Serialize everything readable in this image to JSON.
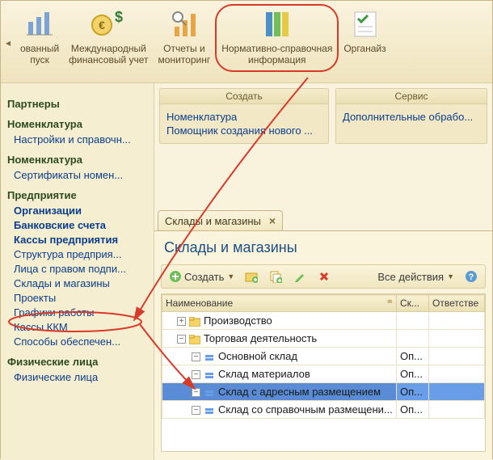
{
  "toolbar": {
    "items": [
      {
        "label1": "ованный",
        "label2": "пуск"
      },
      {
        "label1": "Международный",
        "label2": "финансовый учет"
      },
      {
        "label1": "Отчеты и",
        "label2": "мониторинг"
      },
      {
        "label1": "Нормативно-справочная",
        "label2": "информация"
      },
      {
        "label1": "Органайз",
        "label2": ""
      }
    ]
  },
  "sidebar": {
    "g1": {
      "h": "Партнеры"
    },
    "g1b": {
      "h": "Номенклатура"
    },
    "links1": {
      "settings": "Настройки и справочн..."
    },
    "group_nomen": "Номенклатура",
    "links2": {
      "cert": "Сертификаты номен..."
    },
    "group_ent": "Предприятие",
    "links3": {
      "org": "Организации",
      "bank": "Банковские счета",
      "kassy": "Кассы предприятия",
      "struct": "Структура предприя...",
      "persons": "Лица с правом подпи...",
      "warehouses": "Склады и магазины",
      "projects": "Проекты",
      "schedules": "Графики работы",
      "kkm": "Кассы ККМ",
      "methods": "Способы обеспечен..."
    },
    "group_phys": "Физические лица",
    "links4": {
      "phys": "Физические лица"
    }
  },
  "banners": {
    "create": {
      "title": "Создать",
      "items": [
        "Номенклатура",
        "Помощник создания нового ..."
      ]
    },
    "service": {
      "title": "Сервис",
      "items": [
        "Дополнительные обрабо..."
      ]
    }
  },
  "tab": {
    "title": "Склады и магазины"
  },
  "page": {
    "title": "Склады и магазины"
  },
  "gridtb": {
    "create": "Создать",
    "actions": "Все действия"
  },
  "grid": {
    "headers": {
      "name": "Наименование",
      "sk": "Ск...",
      "resp": "Ответстве"
    },
    "rows": [
      {
        "kind": "folder",
        "indent": 0,
        "exp": "+",
        "name": "Производство",
        "sk": "",
        "resp": ""
      },
      {
        "kind": "folder",
        "indent": 0,
        "exp": "−",
        "name": "Торговая деятельность",
        "sk": "",
        "resp": ""
      },
      {
        "kind": "item",
        "indent": 1,
        "exp": "−",
        "name": "Основной склад",
        "sk": "Оп...",
        "resp": ""
      },
      {
        "kind": "item",
        "indent": 1,
        "exp": "−",
        "name": "Склад материалов",
        "sk": "Оп...",
        "resp": ""
      },
      {
        "kind": "item",
        "indent": 1,
        "exp": "−",
        "name": "Склад с адресным размещением",
        "sk": "Оп...",
        "resp": "",
        "sel": true
      },
      {
        "kind": "item",
        "indent": 1,
        "exp": "−",
        "name": "Склад со справочным размещени...",
        "sk": "Оп...",
        "resp": ""
      }
    ]
  }
}
